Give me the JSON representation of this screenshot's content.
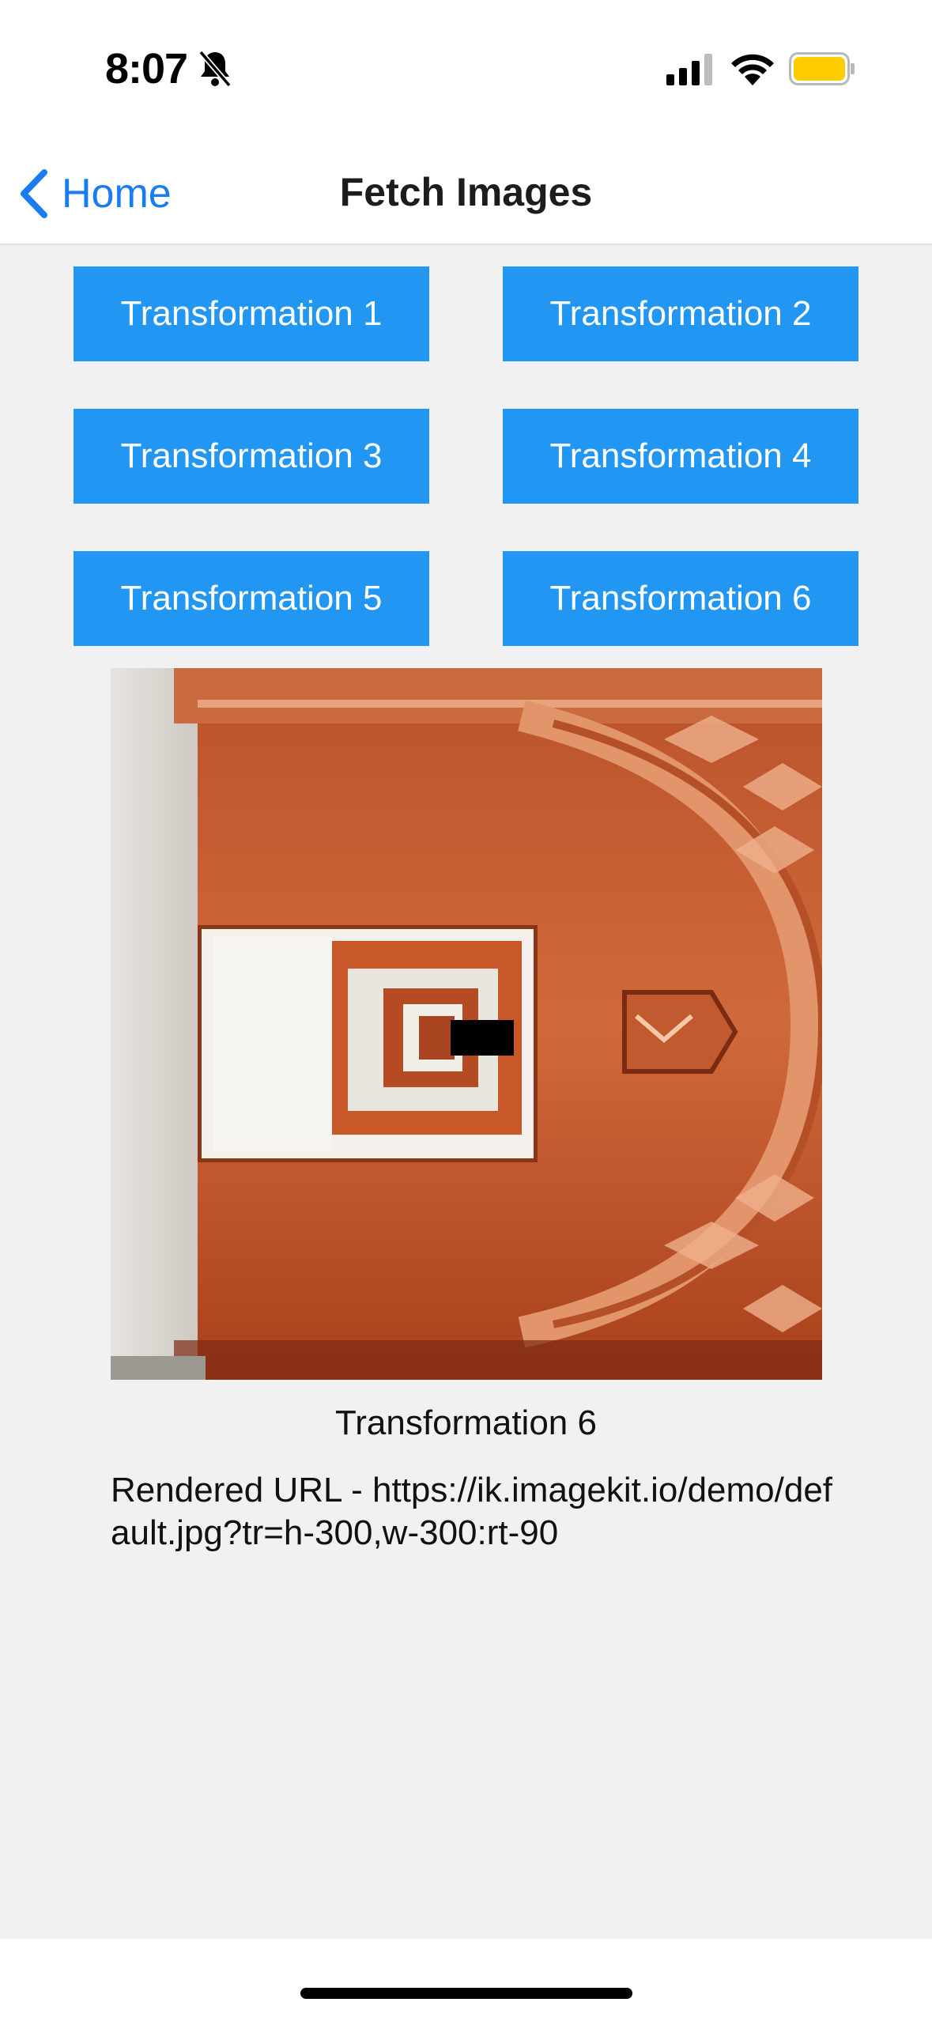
{
  "status_bar": {
    "time": "8:07",
    "icons": [
      "bell-slash-icon",
      "cellular-signal-icon",
      "wifi-icon",
      "battery-icon"
    ],
    "battery_color": "#ffcc00"
  },
  "nav": {
    "back_label": "Home",
    "title": "Fetch Images",
    "accent": "#1a7cf2"
  },
  "buttons": [
    {
      "label": "Transformation 1"
    },
    {
      "label": "Transformation 2"
    },
    {
      "label": "Transformation 3"
    },
    {
      "label": "Transformation 4"
    },
    {
      "label": "Transformation 5"
    },
    {
      "label": "Transformation 6"
    }
  ],
  "button_color": "#2196f3",
  "result": {
    "caption": "Transformation 6",
    "url_text": "Rendered URL - https://ik.imagekit.io/demo/default.jpg?tr=h-300,w-300:rt-90"
  }
}
